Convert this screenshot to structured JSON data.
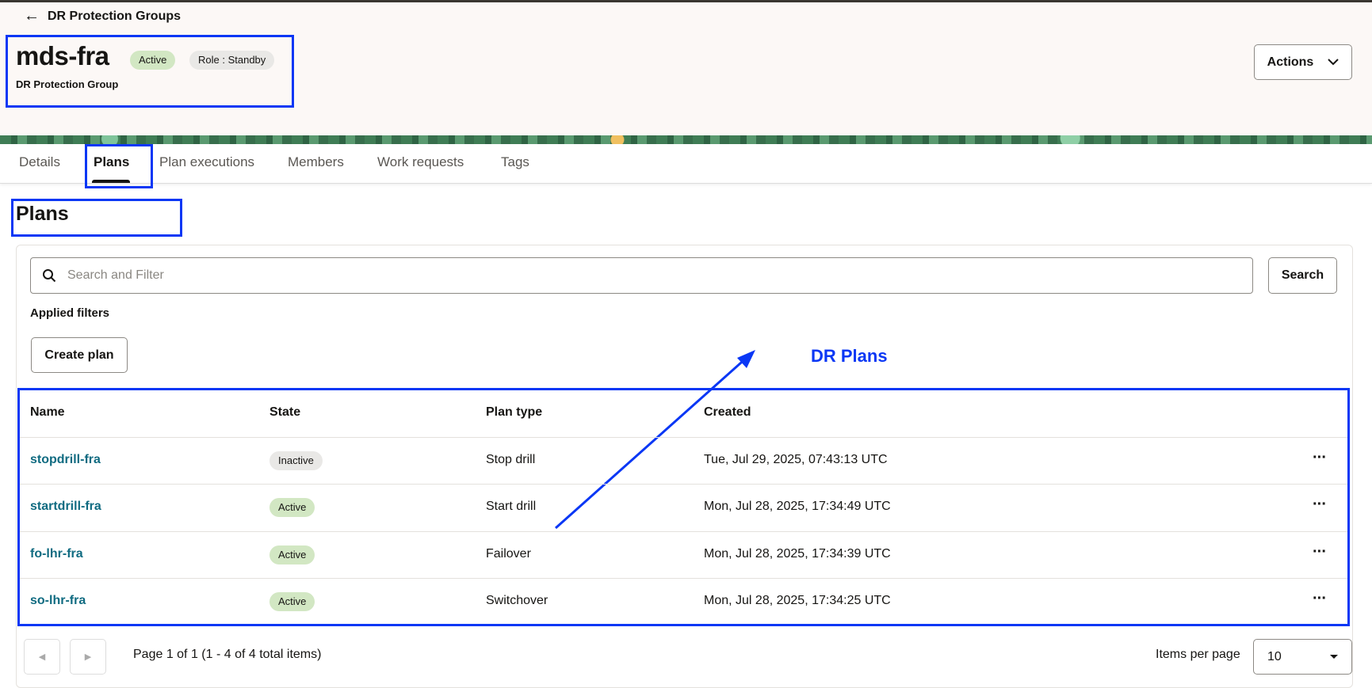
{
  "breadcrumb": {
    "back_label": "DR Protection Groups"
  },
  "resource": {
    "name": "mds-fra",
    "state_badge": "Active",
    "role_badge": "Role : Standby",
    "type": "DR Protection Group"
  },
  "actions_label": "Actions",
  "tabs": [
    {
      "label": "Details"
    },
    {
      "label": "Plans"
    },
    {
      "label": "Plan executions"
    },
    {
      "label": "Members"
    },
    {
      "label": "Work requests"
    },
    {
      "label": "Tags"
    }
  ],
  "section_title": "Plans",
  "search": {
    "placeholder": "Search and Filter",
    "value": "",
    "button_label": "Search"
  },
  "applied_filters_label": "Applied filters",
  "create_plan_label": "Create plan",
  "annotation": {
    "label": "DR Plans",
    "color": "#0a37f5"
  },
  "table": {
    "columns": [
      "Name",
      "State",
      "Plan type",
      "Created"
    ],
    "rows": [
      {
        "name": "stopdrill-fra",
        "state": "Inactive",
        "plan_type": "Stop drill",
        "created": "Tue, Jul 29, 2025, 07:43:13 UTC"
      },
      {
        "name": "startdrill-fra",
        "state": "Active",
        "plan_type": "Start drill",
        "created": "Mon, Jul 28, 2025, 17:34:49 UTC"
      },
      {
        "name": "fo-lhr-fra",
        "state": "Active",
        "plan_type": "Failover",
        "created": "Mon, Jul 28, 2025, 17:34:39 UTC"
      },
      {
        "name": "so-lhr-fra",
        "state": "Active",
        "plan_type": "Switchover",
        "created": "Mon, Jul 28, 2025, 17:34:25 UTC"
      }
    ]
  },
  "pagination": {
    "summary": "Page 1 of 1 (1 - 4 of 4 total items)",
    "items_per_page_label": "Items per page",
    "items_per_page": "10"
  }
}
